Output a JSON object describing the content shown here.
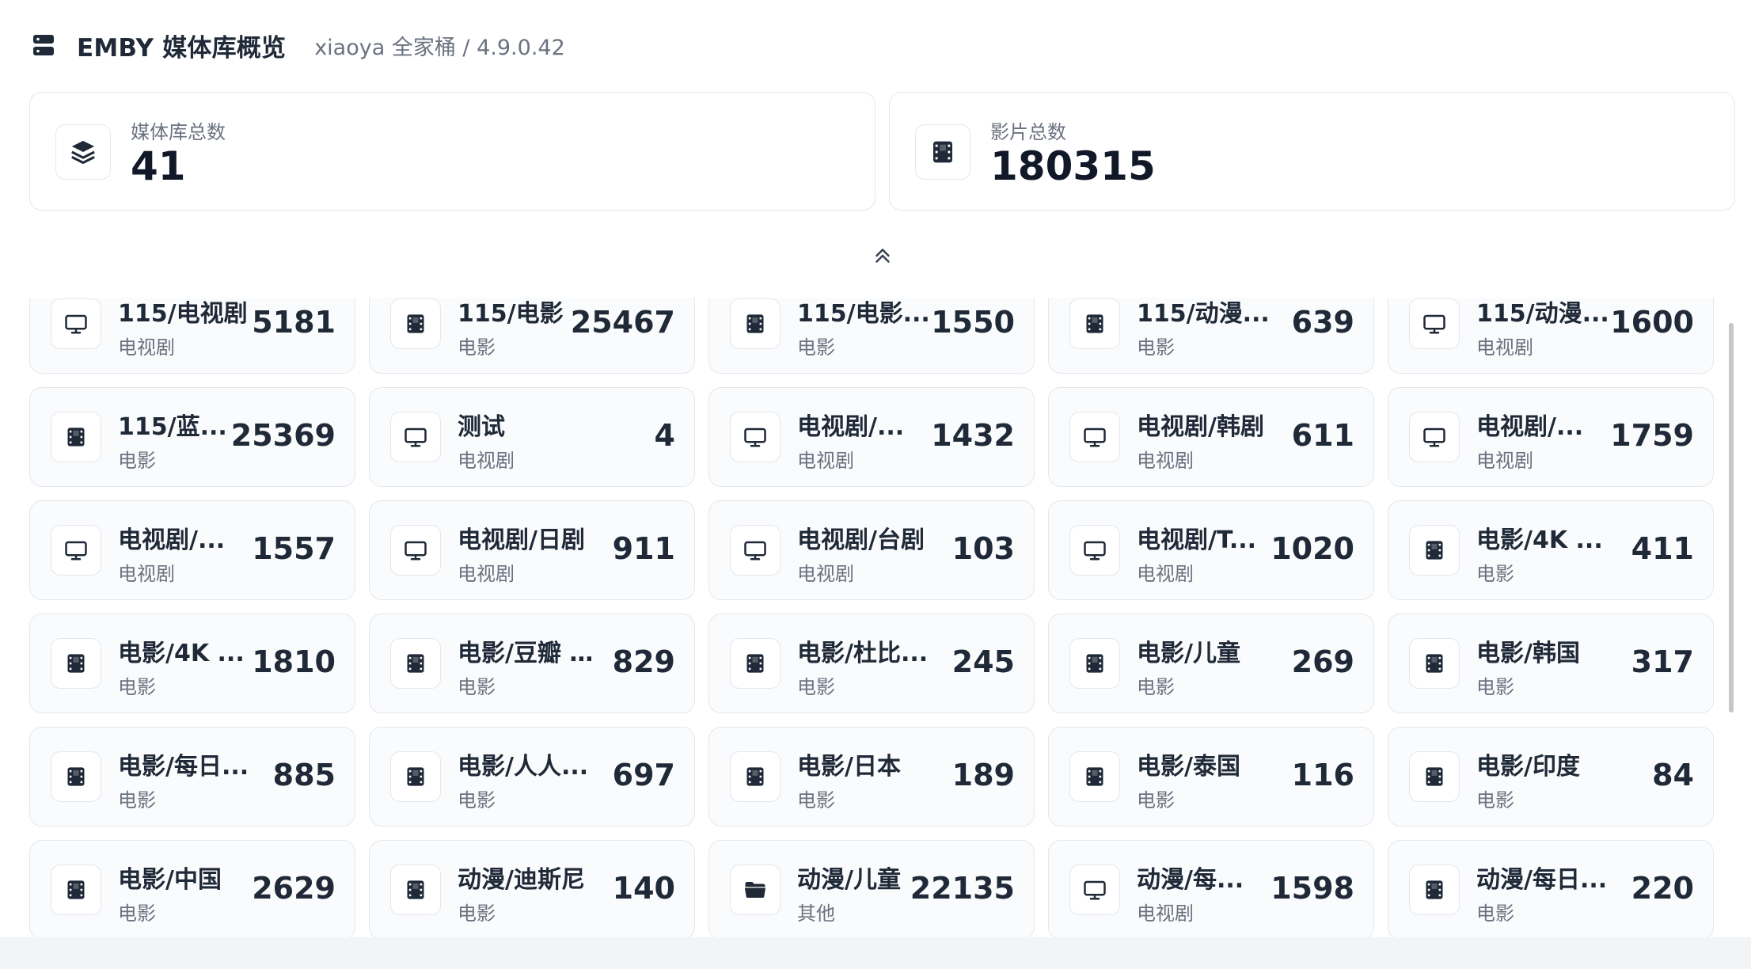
{
  "header": {
    "icon": "server-icon",
    "title": "EMBY 媒体库概览",
    "subtitle": "xiaoya 全家桶 / 4.9.0.42"
  },
  "stats": {
    "libraries": {
      "icon": "layers-icon",
      "label": "媒体库总数",
      "value": "41"
    },
    "movies": {
      "icon": "film-icon",
      "label": "影片总数",
      "value": "180315"
    }
  },
  "collapse": {
    "icon": "chevrons-up-icon"
  },
  "libraries": [
    {
      "name": "115/电视剧",
      "type": "电视剧",
      "count": "5181",
      "icon": "tv-icon"
    },
    {
      "name": "115/电影",
      "type": "电影",
      "count": "25467",
      "icon": "film-icon"
    },
    {
      "name": "115/电影...",
      "type": "电影",
      "count": "1550",
      "icon": "film-icon"
    },
    {
      "name": "115/动漫...",
      "type": "电影",
      "count": "639",
      "icon": "film-icon"
    },
    {
      "name": "115/动漫...",
      "type": "电视剧",
      "count": "1600",
      "icon": "tv-icon"
    },
    {
      "name": "115/蓝...",
      "type": "电影",
      "count": "25369",
      "icon": "film-icon"
    },
    {
      "name": "测试",
      "type": "电视剧",
      "count": "4",
      "icon": "tv-icon"
    },
    {
      "name": "电视剧/...",
      "type": "电视剧",
      "count": "1432",
      "icon": "tv-icon"
    },
    {
      "name": "电视剧/韩剧",
      "type": "电视剧",
      "count": "611",
      "icon": "tv-icon"
    },
    {
      "name": "电视剧/...",
      "type": "电视剧",
      "count": "1759",
      "icon": "tv-icon"
    },
    {
      "name": "电视剧/...",
      "type": "电视剧",
      "count": "1557",
      "icon": "tv-icon"
    },
    {
      "name": "电视剧/日剧",
      "type": "电视剧",
      "count": "911",
      "icon": "tv-icon"
    },
    {
      "name": "电视剧/台剧",
      "type": "电视剧",
      "count": "103",
      "icon": "tv-icon"
    },
    {
      "name": "电视剧/T...",
      "type": "电视剧",
      "count": "1020",
      "icon": "tv-icon"
    },
    {
      "name": "电影/4K ...",
      "type": "电影",
      "count": "411",
      "icon": "film-icon"
    },
    {
      "name": "电影/4K ...",
      "type": "电影",
      "count": "1810",
      "icon": "film-icon"
    },
    {
      "name": "电影/豆瓣 ...",
      "type": "电影",
      "count": "829",
      "icon": "film-icon"
    },
    {
      "name": "电影/杜比...",
      "type": "电影",
      "count": "245",
      "icon": "film-icon"
    },
    {
      "name": "电影/儿童",
      "type": "电影",
      "count": "269",
      "icon": "film-icon"
    },
    {
      "name": "电影/韩国",
      "type": "电影",
      "count": "317",
      "icon": "film-icon"
    },
    {
      "name": "电影/每日...",
      "type": "电影",
      "count": "885",
      "icon": "film-icon"
    },
    {
      "name": "电影/人人...",
      "type": "电影",
      "count": "697",
      "icon": "film-icon"
    },
    {
      "name": "电影/日本",
      "type": "电影",
      "count": "189",
      "icon": "film-icon"
    },
    {
      "name": "电影/泰国",
      "type": "电影",
      "count": "116",
      "icon": "film-icon"
    },
    {
      "name": "电影/印度",
      "type": "电影",
      "count": "84",
      "icon": "film-icon"
    },
    {
      "name": "电影/中国",
      "type": "电影",
      "count": "2629",
      "icon": "film-icon"
    },
    {
      "name": "动漫/迪斯尼",
      "type": "电影",
      "count": "140",
      "icon": "film-icon"
    },
    {
      "name": "动漫/儿童",
      "type": "其他",
      "count": "22135",
      "icon": "folder-icon"
    },
    {
      "name": "动漫/每...",
      "type": "电视剧",
      "count": "1598",
      "icon": "tv-icon"
    },
    {
      "name": "动漫/每日...",
      "type": "电影",
      "count": "220",
      "icon": "film-icon"
    }
  ]
}
